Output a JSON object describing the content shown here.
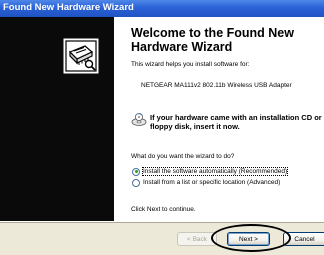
{
  "window": {
    "title": "Found New Hardware Wizard"
  },
  "wizard": {
    "heading": "Welcome to the Found New Hardware Wizard",
    "intro": "This wizard helps you install software for:",
    "device_name": "NETGEAR MA111v2 802.11b Wireless USB Adapter",
    "cd_prompt": "If your hardware came with an installation CD or floppy disk, insert it now.",
    "question": "What do you want the wizard to do?",
    "options": [
      {
        "label": "Install the software automatically (Recommended)",
        "selected": true
      },
      {
        "label": "Install from a list or specific location (Advanced)",
        "selected": false
      }
    ],
    "continue_text": "Click Next to continue."
  },
  "buttons": {
    "back_label": "< Back",
    "next_label": "Next >",
    "cancel_label": "Cancel"
  },
  "icons": {
    "wizard_logo": "hardware-wizard-icon",
    "cd": "cd-icon"
  },
  "colors": {
    "titlebar": "#2a61d6",
    "left_panel": "#0a0a0a",
    "button_bar": "#ece9d8",
    "radio_selected": "#21a121"
  }
}
